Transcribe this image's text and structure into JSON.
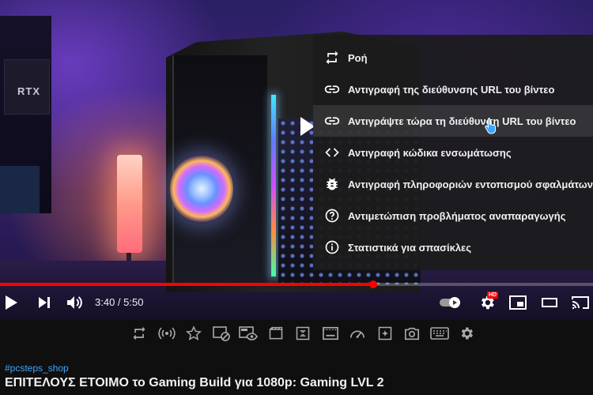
{
  "context_menu": {
    "items": [
      {
        "label": "Ροή",
        "icon": "loop-icon"
      },
      {
        "label": "Αντιγραφή της διεύθυνσης URL του βίντεο",
        "icon": "link-icon"
      },
      {
        "label": "Αντιγράψτε τώρα τη διεύθυνση URL του βίντεο",
        "icon": "link-icon"
      },
      {
        "label": "Αντιγραφή κώδικα ενσωμάτωσης",
        "icon": "embed-code-icon"
      },
      {
        "label": "Αντιγραφή πληροφοριών εντοπισμού σφαλμάτων",
        "icon": "bug-icon"
      },
      {
        "label": "Αντιμετώπιση προβλήματος αναπαραγωγής",
        "icon": "help-icon"
      },
      {
        "label": "Στατιστικά για σπασίκλες",
        "icon": "info-icon"
      }
    ],
    "hovered_index": 2
  },
  "player": {
    "scene_text": "RTX",
    "current_time": "3:40",
    "duration": "5:50",
    "time_display": "3:40 / 5:50",
    "progress_fraction": 0.629,
    "quality_badge": "HD",
    "autoplay": true,
    "accent_color": "#ff0000"
  },
  "toolbar": {
    "icons": [
      "loop-icon",
      "broadcast-icon",
      "star-icon",
      "screenshot-off-icon",
      "watch-icon",
      "film-icon",
      "compress-icon",
      "subtitles-icon",
      "speedometer-icon",
      "sparkle-icon",
      "camera-icon",
      "keyboard-icon",
      "settings-icon"
    ]
  },
  "video": {
    "hashtag": "#pcsteps_shop",
    "title": "ΕΠΙΤΕΛΟΥΣ ΕΤΟΙΜΟ το Gaming Build για 1080p: Gaming LVL 2",
    "hashtag_color": "#3ea6ff"
  }
}
